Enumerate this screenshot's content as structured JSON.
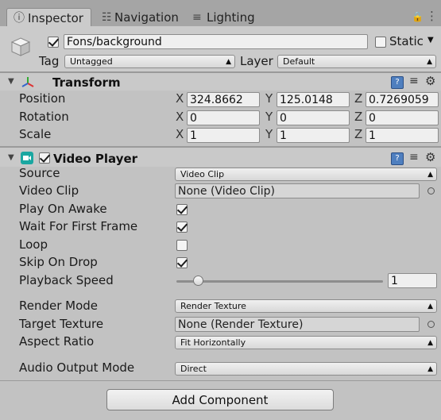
{
  "tabs": [
    {
      "label": "Inspector",
      "icon": "info-icon",
      "active": true
    },
    {
      "label": "Navigation",
      "icon": "navigation-icon",
      "active": false
    },
    {
      "label": "Lighting",
      "icon": "lighting-icon",
      "active": false
    }
  ],
  "object": {
    "name": "Fons/background",
    "active": true,
    "static_label": "Static",
    "static": false,
    "tag_label": "Tag",
    "tag_value": "Untagged",
    "layer_label": "Layer",
    "layer_value": "Default"
  },
  "transform": {
    "title": "Transform",
    "rows": [
      {
        "label": "Position",
        "x": "324.8662",
        "y": "125.0148",
        "z": "0.7269059"
      },
      {
        "label": "Rotation",
        "x": "0",
        "y": "0",
        "z": "0"
      },
      {
        "label": "Scale",
        "x": "1",
        "y": "1",
        "z": "1"
      }
    ],
    "axes": {
      "x": "X",
      "y": "Y",
      "z": "Z"
    }
  },
  "video_player": {
    "title": "Video Player",
    "enabled": true,
    "source_label": "Source",
    "source_value": "Video Clip",
    "clip_label": "Video Clip",
    "clip_value": "None (Video Clip)",
    "play_on_awake_label": "Play On Awake",
    "play_on_awake": true,
    "wait_first_frame_label": "Wait For First Frame",
    "wait_first_frame": true,
    "loop_label": "Loop",
    "loop": false,
    "skip_on_drop_label": "Skip On Drop",
    "skip_on_drop": true,
    "playback_speed_label": "Playback Speed",
    "playback_speed": "1",
    "render_mode_label": "Render Mode",
    "render_mode_value": "Render Texture",
    "target_texture_label": "Target Texture",
    "target_texture_value": "None (Render Texture)",
    "aspect_ratio_label": "Aspect Ratio",
    "aspect_ratio_value": "Fit Horizontally",
    "audio_output_label": "Audio Output Mode",
    "audio_output_value": "Direct"
  },
  "add_component_label": "Add Component",
  "colors": {
    "tabbar": "#a5a5a5",
    "panel": "#c2c2c2",
    "video_icon": "#1aa7a1",
    "transform_red": "#d33",
    "help_blue": "#4f7fbf"
  }
}
